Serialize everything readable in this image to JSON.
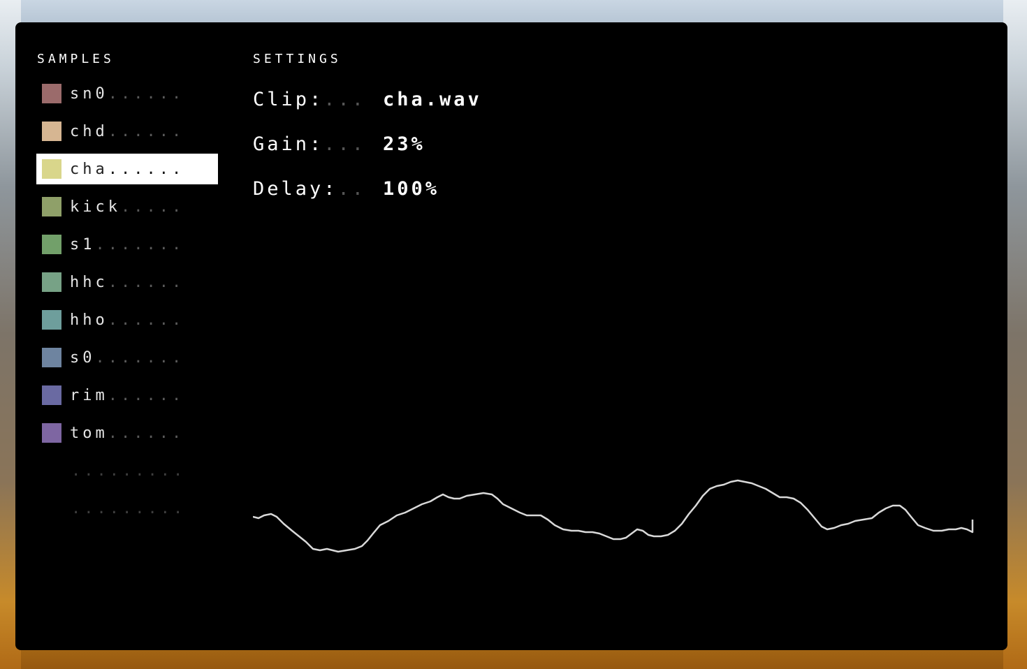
{
  "samples_panel": {
    "heading": "SAMPLES",
    "items": [
      {
        "name": "sn0",
        "dots": "......",
        "color": "#9b6b6b",
        "selected": false
      },
      {
        "name": "chd",
        "dots": "......",
        "color": "#d6b692",
        "selected": false
      },
      {
        "name": "cha",
        "dots": "......",
        "color": "#d9d68b",
        "selected": true
      },
      {
        "name": "kick",
        "dots": ".....",
        "color": "#8fa069",
        "selected": false
      },
      {
        "name": "s1",
        "dots": ".......",
        "color": "#72a06a",
        "selected": false
      },
      {
        "name": "hhc",
        "dots": "......",
        "color": "#77a286",
        "selected": false
      },
      {
        "name": "hho",
        "dots": "......",
        "color": "#6e9e9c",
        "selected": false
      },
      {
        "name": "s0",
        "dots": ".......",
        "color": "#6e84a0",
        "selected": false
      },
      {
        "name": "rim",
        "dots": "......",
        "color": "#6a6aa2",
        "selected": false
      },
      {
        "name": "tom",
        "dots": "......",
        "color": "#7e66a2",
        "selected": false
      }
    ],
    "empty_slots": [
      ".........",
      "........."
    ]
  },
  "settings_panel": {
    "heading": "SETTINGS",
    "clip": {
      "label": "Clip:",
      "dots": "...",
      "value": "cha.wav"
    },
    "gain": {
      "label": "Gain:",
      "dots": "...",
      "value": "23%"
    },
    "delay": {
      "label": "Delay:",
      "dots": "..",
      "value": "100%"
    }
  }
}
